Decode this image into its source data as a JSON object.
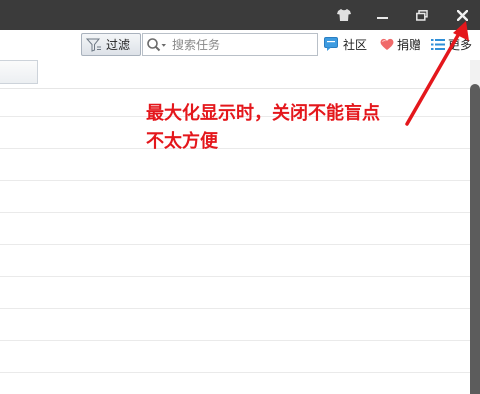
{
  "window": {
    "controls": {
      "skin_icon": "tshirt-icon",
      "minimize_icon": "minimize-icon",
      "restore_icon": "restore-icon",
      "close_icon": "close-icon"
    }
  },
  "toolbar": {
    "filter_label": "过滤",
    "search": {
      "placeholder": "搜索任务",
      "value": ""
    },
    "links": {
      "community": "社区",
      "donate": "捐赠",
      "more": "更多"
    }
  },
  "annotation": {
    "line1": "最大化显示时，关闭不能盲点",
    "line2": "不太方便",
    "color": "#e4171c"
  },
  "colors": {
    "titlebar": "#3b3b3b",
    "scroll_thumb": "#5c5c5c"
  }
}
